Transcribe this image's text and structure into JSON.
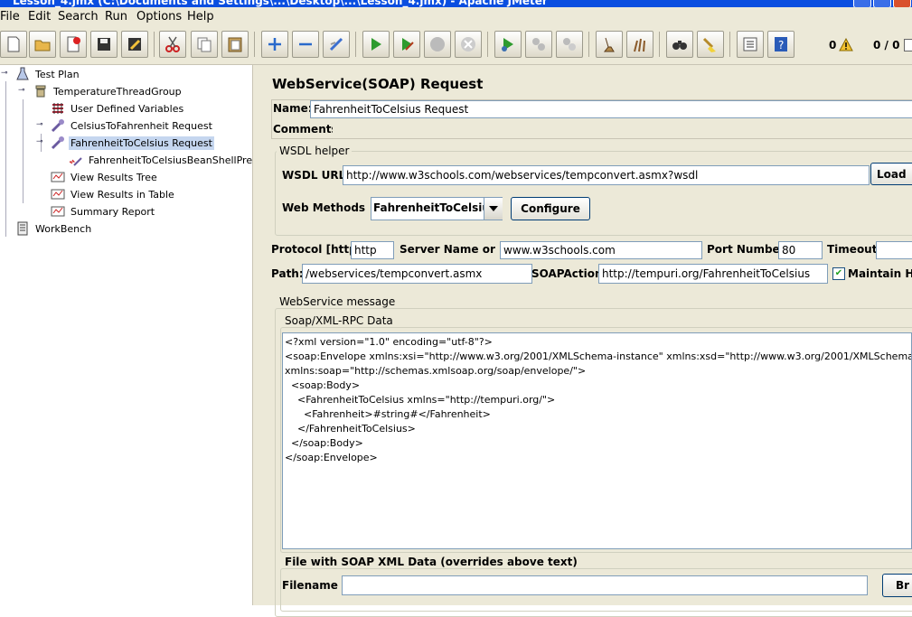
{
  "window": {
    "title": "Lesson_4.jmx (C:\\Documents and Settings\\...\\Desktop\\...\\Lesson_4.jmx) - Apache JMeter"
  },
  "menu": [
    "File",
    "Edit",
    "Search",
    "Run",
    "Options",
    "Help"
  ],
  "toolbar": {
    "icons": [
      "new-icon",
      "open-icon",
      "close-file-icon",
      "save-icon",
      "save-as-icon",
      "cut-icon",
      "copy-icon",
      "paste-icon",
      "expand-icon",
      "collapse-icon",
      "toggle-icon",
      "start-icon",
      "start-no-pause-icon",
      "stop-icon",
      "shutdown-icon",
      "remote-start-icon",
      "remote-stop-icon",
      "remote-exit-icon",
      "clear-icon",
      "clear-all-icon",
      "search-icon",
      "reset-search-icon",
      "function-helper-icon",
      "help-icon"
    ],
    "warning_count": "0",
    "threads": "0 / 0"
  },
  "tree": {
    "items": [
      {
        "label": "Test Plan",
        "icon": "test-plan-icon",
        "depth": 0
      },
      {
        "label": "TemperatureThreadGroup",
        "icon": "thread-group-icon",
        "depth": 1
      },
      {
        "label": "User Defined Variables",
        "icon": "config-icon",
        "depth": 2
      },
      {
        "label": "CelsiusToFahrenheit Request",
        "icon": "sampler-icon",
        "depth": 2
      },
      {
        "label": "FahrenheitToCelsius Request",
        "icon": "sampler-icon",
        "depth": 2,
        "selected": true
      },
      {
        "label": "FahrenheitToCelsiusBeanShellPreProcessor",
        "icon": "preprocessor-icon",
        "depth": 3
      },
      {
        "label": "View Results Tree",
        "icon": "listener-icon",
        "depth": 2
      },
      {
        "label": "View Results in Table",
        "icon": "listener-icon",
        "depth": 2
      },
      {
        "label": "Summary Report",
        "icon": "listener-icon",
        "depth": 2
      },
      {
        "label": "WorkBench",
        "icon": "workbench-icon",
        "depth": 0
      }
    ]
  },
  "panel": {
    "heading": "WebService(SOAP) Request",
    "name_label": "Name:",
    "name_value": "FahrenheitToCelsius Request",
    "comments_label": "Comments:",
    "wsdl_helper": {
      "title": "WSDL helper",
      "url_label": "WSDL URL",
      "url_value": "http://www.w3schools.com/webservices/tempconvert.asmx?wsdl",
      "load_button": "Load",
      "methods_label": "Web Methods",
      "method_selected": "FahrenheitToCelsius",
      "configure_button": "Configure"
    },
    "protocol_label": "Protocol [http]:",
    "protocol_value": "http",
    "server_label": "Server Name or IP:",
    "server_value": "www.w3schools.com",
    "port_label": "Port Number:",
    "port_value": "80",
    "timeout_label": "Timeout:",
    "timeout_value": "",
    "path_label": "Path:",
    "path_value": "/webservices/tempconvert.asmx",
    "soapaction_label": "SOAPAction",
    "soapaction_value": "http://tempuri.org/FahrenheitToCelsius",
    "maintain_label": "Maintain HTT",
    "maintain_checked": true,
    "message": {
      "title": "WebService message",
      "soap_title": "Soap/XML-RPC Data",
      "soap_data": "<?xml version=\"1.0\" encoding=\"utf-8\"?>\n<soap:Envelope xmlns:xsi=\"http://www.w3.org/2001/XMLSchema-instance\" xmlns:xsd=\"http://www.w3.org/2001/XMLSchema\"\nxmlns:soap=\"http://schemas.xmlsoap.org/soap/envelope/\">\n  <soap:Body>\n    <FahrenheitToCelsius xmlns=\"http://tempuri.org/\">\n      <Fahrenheit>#string#</Fahrenheit>\n    </FahrenheitToCelsius>\n  </soap:Body>\n</soap:Envelope>",
      "file_title": "File with SOAP XML Data (overrides above text)",
      "filename_label": "Filename",
      "filename_value": "",
      "browse_button": "Br"
    }
  }
}
